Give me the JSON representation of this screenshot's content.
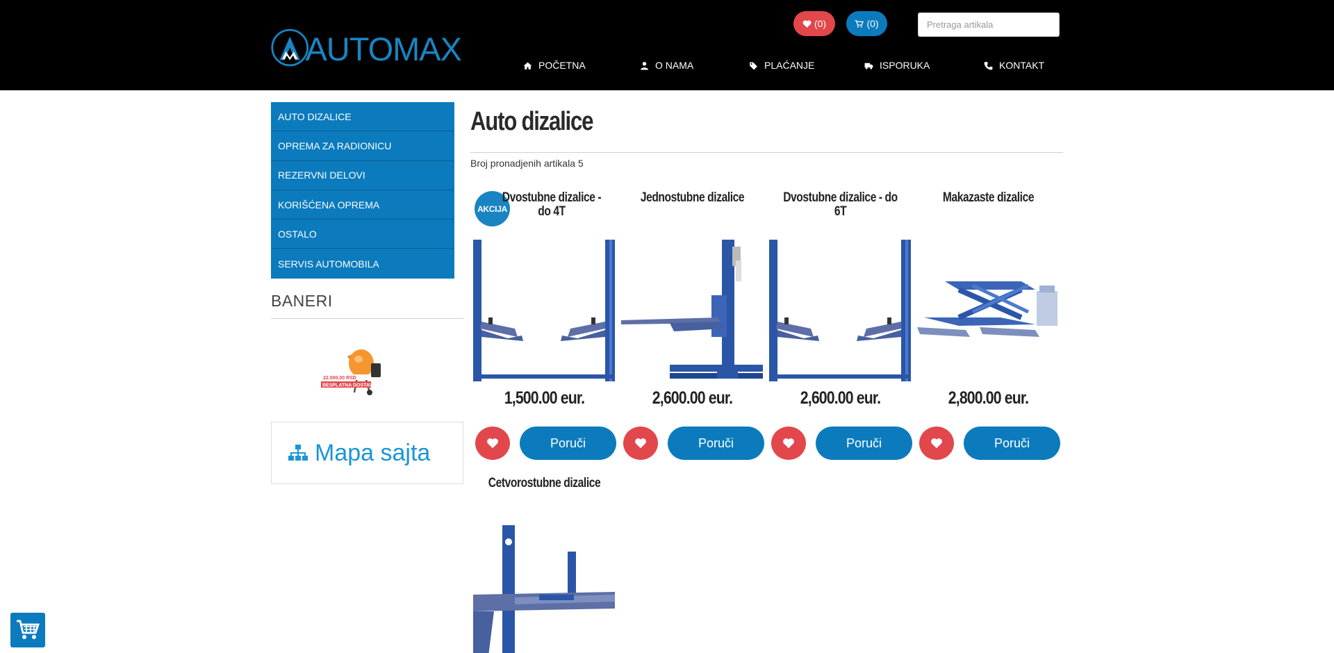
{
  "header": {
    "logo_text": "AUTOMAX",
    "wishlist_count": "(0)",
    "cart_count": "(0)",
    "search_placeholder": "Pretraga artikala",
    "nav": [
      {
        "label": "POČETNA",
        "icon": "home-icon"
      },
      {
        "label": "O NAMA",
        "icon": "user-icon"
      },
      {
        "label": "PLAĆANJE",
        "icon": "tag-icon"
      },
      {
        "label": "ISPORUKA",
        "icon": "truck-icon"
      },
      {
        "label": "KONTAKT",
        "icon": "phone-icon"
      }
    ]
  },
  "sidebar": {
    "categories": [
      "AUTO DIZALICE",
      "OPREMA ZA RADIONICU",
      "REZERVNI DELOVI",
      "KORIŠĆENA OPREMA",
      "OSTALO",
      "SERVIS AUTOMOBILA"
    ],
    "banners_title": "BANERI",
    "banner": {
      "phone": "22.000,00 RSD",
      "caption": "BESPLATNA DOSTAVA"
    },
    "sitemap_label": "Mapa sajta"
  },
  "main": {
    "title": "Auto dizalice",
    "found_text": "Broj pronadjenih artikala 5",
    "order_label": "Poruči",
    "sale_badge": "AKCIJA",
    "products": [
      {
        "name": "Dvostubne dizalice - do 4T",
        "price": "1,500.00 eur.",
        "sale": true
      },
      {
        "name": "Jednostubne dizalice",
        "price": "2,600.00 eur.",
        "sale": false
      },
      {
        "name": "Dvostubne dizalice - do 6T",
        "price": "2,600.00 eur.",
        "sale": false
      },
      {
        "name": "Makazaste dizalice",
        "price": "2,800.00 eur.",
        "sale": false
      },
      {
        "name": "Četvorostubne dizalice",
        "price": "",
        "sale": false
      }
    ]
  },
  "colors": {
    "brand_blue": "#0b7bbd",
    "wish_red": "#e2474b",
    "header_bg": "#000000"
  }
}
